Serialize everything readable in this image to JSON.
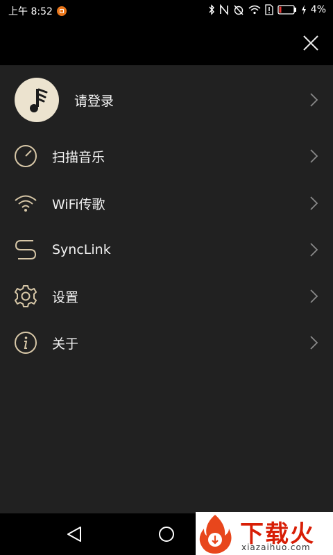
{
  "status_bar": {
    "time": "上午 8:52",
    "battery": "4%",
    "icons": [
      "notification-icon",
      "bluetooth-icon",
      "nfc-icon",
      "alarm-off-icon",
      "wifi-icon",
      "sim-alert-icon",
      "battery-icon",
      "charging-icon"
    ]
  },
  "top_bar": {
    "close_icon": "close-icon"
  },
  "menu": {
    "login_label": "请登录",
    "items": [
      {
        "label": "扫描音乐",
        "icon": "scan-dial-icon"
      },
      {
        "label": "WiFi传歌",
        "icon": "wifi-icon"
      },
      {
        "label": "SyncLink",
        "icon": "synclink-icon"
      },
      {
        "label": "设置",
        "icon": "gear-icon"
      },
      {
        "label": "关于",
        "icon": "info-icon"
      }
    ]
  },
  "colors": {
    "accent": "#d8c8a8",
    "background": "#212121",
    "top": "#000000",
    "avatar": "#ece3cf"
  },
  "watermark": {
    "title": "下载火",
    "subtitle": "xiazaihuo.com"
  }
}
